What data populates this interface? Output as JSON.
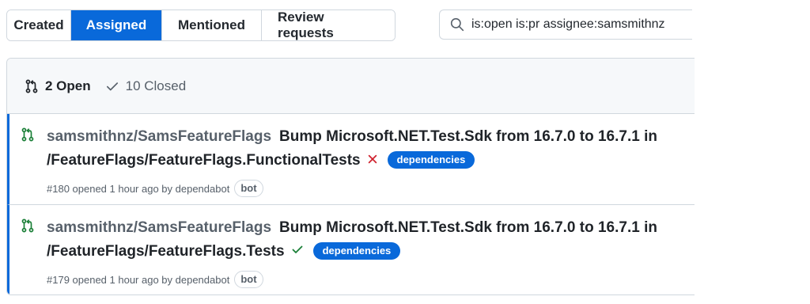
{
  "tabs": [
    {
      "label": "Created",
      "selected": false
    },
    {
      "label": "Assigned",
      "selected": true
    },
    {
      "label": "Mentioned",
      "selected": false
    },
    {
      "label": "Review requests",
      "selected": false
    }
  ],
  "search": {
    "value": "is:open is:pr assignee:samsmithnz",
    "icon": "search-icon"
  },
  "state_filter": {
    "open_label": "2 Open",
    "closed_label": "10 Closed"
  },
  "pull_requests": [
    {
      "repo": "samsmithnz/SamsFeatureFlags",
      "title": "Bump Microsoft.NET.Test.Sdk from 16.7.0 to 16.7.1 in /FeatureFlags/FeatureFlags.FunctionalTests",
      "status": "failure",
      "label": "dependencies",
      "meta": "#180 opened 1 hour ago by dependabot",
      "author_badge": "bot"
    },
    {
      "repo": "samsmithnz/SamsFeatureFlags",
      "title": "Bump Microsoft.NET.Test.Sdk from 16.7.0 to 16.7.1 in /FeatureFlags/FeatureFlags.Tests",
      "status": "success",
      "label": "dependencies",
      "meta": "#179 opened 1 hour ago by dependabot",
      "author_badge": "bot"
    }
  ],
  "colors": {
    "accent": "#0969da",
    "open_green": "#1a7f37",
    "fail_red": "#cf222e",
    "border": "#d0d7de",
    "muted": "#57606a"
  }
}
